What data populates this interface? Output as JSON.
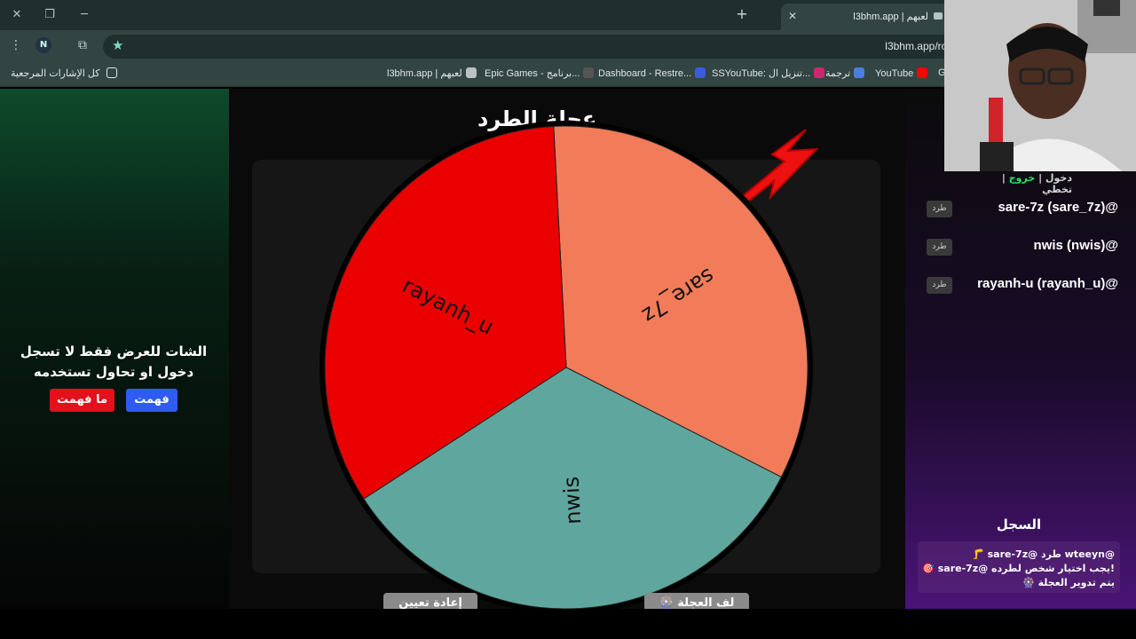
{
  "browser": {
    "tab_title": "l3bhm.app | لعبهم",
    "url": "l3bhm.app/roll/nwis",
    "profile_initial": "N",
    "bookmarks": [
      {
        "label": "YouTube",
        "icon": "youtube-icon",
        "color": "#ff0000"
      },
      {
        "label": "ترجمة",
        "icon": "translate-icon",
        "color": "#4a7fe0"
      },
      {
        "label": "SSYouTube: تنزيل ال...",
        "icon": "ssyoutube-icon",
        "color": "#d02670"
      },
      {
        "label": "Dashboard - Restre...",
        "icon": "restream-icon",
        "color": "#3b5bdb"
      },
      {
        "label": "Epic Games - برنامج...",
        "icon": "epic-icon",
        "color": "#2a2a2a"
      },
      {
        "label": "l3bhm.app | لعبهم",
        "icon": "l3bhm-icon",
        "color": "#b8c4c2"
      },
      {
        "label": "G",
        "icon": "g-icon",
        "color": "#324543"
      }
    ],
    "all_bookmarks_label": "كل الإشارات المرجعية"
  },
  "left": {
    "notice": "الشات للعرض فقط لا تسجل دخول او تحاول تستخدمه",
    "understood_label": "فهمت",
    "not_understood_label": "ما فهمت"
  },
  "wheel": {
    "title": "عجلة الطرد",
    "segments": [
      {
        "name": "sare_7z",
        "color": "#f27c5a"
      },
      {
        "name": "nwis",
        "color": "#5fa79e"
      },
      {
        "name": "rayanh_u",
        "color": "#ea0000"
      }
    ],
    "spin_label": "🎡 لف العجلة",
    "reset_label": "إعادة تعيين"
  },
  "right": {
    "controls": {
      "login": "دخول",
      "logout": "خروج",
      "skip": "تخطي"
    },
    "players": [
      {
        "name": "sare-7z (sare_7z)@",
        "kick": "طرد"
      },
      {
        "name": "nwis (nwis)@",
        "kick": "طرد"
      },
      {
        "name": "rayanh-u (rayanh_u)@",
        "kick": "طرد"
      }
    ],
    "log_title": "السجل",
    "log": [
      "🦵 sare-7z@ طرد wteeyn@",
      "🎯 sare-7z@ يجب اختيار شخص لطرده!",
      "🎡 يتم تدوير العجلة"
    ]
  }
}
